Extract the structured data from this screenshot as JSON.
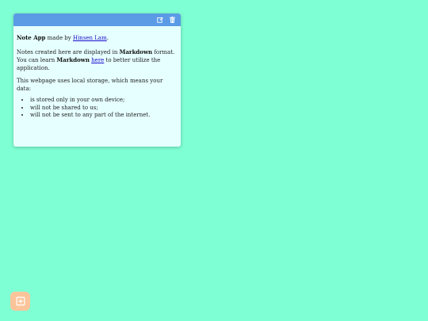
{
  "note": {
    "header_color": "#5b9be6",
    "body_color": "#e6ffff",
    "actions": [
      {
        "icon": "edit-icon"
      },
      {
        "icon": "trash-icon"
      }
    ],
    "intro": {
      "app_name": "Note App",
      "made_by": " made by ",
      "author": "Hinsen Lam",
      "period": "."
    },
    "para1": {
      "t1": "Notes created here are displayed in ",
      "markdown1": "Markdown",
      "t2": " format. You can learn ",
      "markdown2": "Markdown",
      "t3": " ",
      "link": "here",
      "t4": " to better utilize the application."
    },
    "para2": "This webpage uses local storage, which means your data:",
    "list": [
      "is stored only in your own device;",
      "will not be shared to us;",
      "will not be sent to any part of the internet."
    ]
  },
  "add_button": {
    "icon": "plus-square-icon",
    "color": "#fbc49a"
  },
  "background_color": "#7fffd4"
}
